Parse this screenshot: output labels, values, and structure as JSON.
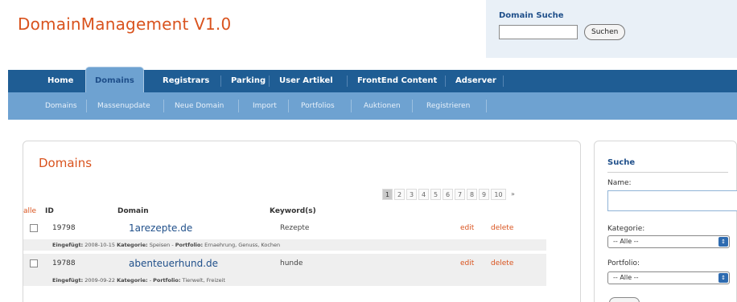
{
  "header": {
    "app_title": "DomainManagement V1.0",
    "search_label": "Domain Suche",
    "search_value": "",
    "search_button": "Suchen"
  },
  "nav": {
    "tabs": [
      {
        "label": "Home",
        "active": false
      },
      {
        "label": "Domains",
        "active": true
      },
      {
        "label": "Registrars",
        "active": false
      },
      {
        "label": "Parking",
        "active": false
      },
      {
        "label": "User Artikel",
        "active": false
      },
      {
        "label": "FrontEnd Content",
        "active": false
      },
      {
        "label": "Adserver",
        "active": false
      }
    ],
    "subtabs": [
      {
        "label": "Domains"
      },
      {
        "label": "Massenupdate"
      },
      {
        "label": "Neue Domain"
      },
      {
        "label": "Import"
      },
      {
        "label": "Portfolios"
      },
      {
        "label": "Auktionen"
      },
      {
        "label": "Registrieren"
      }
    ]
  },
  "main": {
    "title": "Domains",
    "pager": {
      "current": "1",
      "pages": [
        "1",
        "2",
        "3",
        "4",
        "5",
        "6",
        "7",
        "8",
        "9",
        "10"
      ],
      "next": "»"
    },
    "columns": {
      "select_all": "alle",
      "id": "ID",
      "domain": "Domain",
      "keywords": "Keyword(s)"
    },
    "rows": [
      {
        "id": "19798",
        "domain": "1arezepte.de",
        "keyword": "Rezepte",
        "edit": "edit",
        "delete": "delete",
        "detail_label_date": "Eingefügt:",
        "detail_date": "2008-10-15",
        "detail_label_category": "Kategorie:",
        "detail_category": "Speisen",
        "detail_label_portfolio": "Portfolio:",
        "detail_portfolio": "Ernaehrung, Genuss, Kochen"
      },
      {
        "id": "19788",
        "domain": "abenteuerhund.de",
        "keyword": "hunde",
        "edit": "edit",
        "delete": "delete",
        "detail_label_date": "Eingefügt:",
        "detail_date": "2009-09-22",
        "detail_label_category": "Kategorie:",
        "detail_category": "",
        "detail_label_portfolio": "Portfolio:",
        "detail_portfolio": "Tierwelt, Freizeit"
      }
    ]
  },
  "sidebar": {
    "title": "Suche",
    "name_label": "Name:",
    "name_value": "",
    "category_label": "Kategorie:",
    "category_value": "-- Alle --",
    "portfolio_label": "Portfolio:",
    "portfolio_value": "-- Alle --"
  },
  "colors": {
    "accent": "#d9531e",
    "nav_dark": "#1f5d94",
    "nav_light": "#6ea2d1",
    "link": "#1f4f8a"
  }
}
